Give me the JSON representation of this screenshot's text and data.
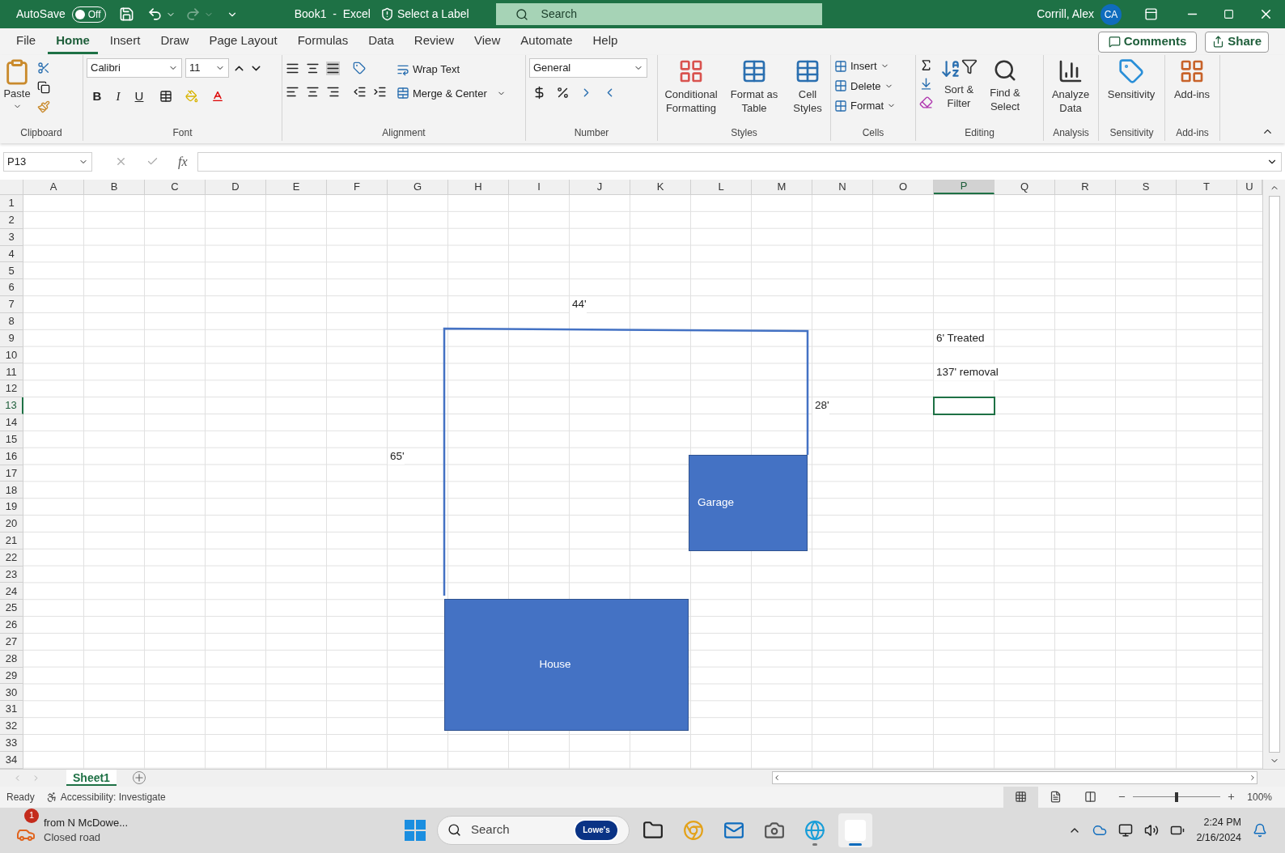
{
  "title_bar": {
    "autosave_label": "AutoSave",
    "autosave_on": false,
    "autosave_state": "Off",
    "document_title": "Book1  -  Excel",
    "sensitivity_label": "Select a Label",
    "search_placeholder": "Search",
    "user_name": "Corrill, Alex",
    "user_initials": "CA"
  },
  "ribbon_tabs": [
    {
      "label": "File",
      "selected": false
    },
    {
      "label": "Home",
      "selected": true
    },
    {
      "label": "Insert",
      "selected": false
    },
    {
      "label": "Draw",
      "selected": false
    },
    {
      "label": "Page Layout",
      "selected": false
    },
    {
      "label": "Formulas",
      "selected": false
    },
    {
      "label": "Data",
      "selected": false
    },
    {
      "label": "Review",
      "selected": false
    },
    {
      "label": "View",
      "selected": false
    },
    {
      "label": "Automate",
      "selected": false
    },
    {
      "label": "Help",
      "selected": false
    }
  ],
  "comments_button": "Comments",
  "share_button": "Share",
  "clipboard": {
    "paste": "Paste",
    "group": "Clipboard"
  },
  "font": {
    "name": "Calibri",
    "size": "11",
    "styles": [
      "B",
      "I",
      "U"
    ],
    "group": "Font"
  },
  "alignment": {
    "wrap_text": "Wrap Text",
    "merge": "Merge & Center",
    "group": "Alignment"
  },
  "number": {
    "format": "General",
    "group": "Number"
  },
  "styles": {
    "buttons": [
      "Conditional Formatting",
      "Format as Table",
      "Cell Styles"
    ],
    "group": "Styles"
  },
  "cells": {
    "buttons": [
      "Insert",
      "Delete",
      "Format"
    ],
    "group": "Cells"
  },
  "editing": {
    "buttons": [
      "Sort & Filter",
      "Find & Select"
    ],
    "group": "Editing"
  },
  "analysis": {
    "button": "Analyze Data",
    "group": "Analysis"
  },
  "sensitivity": {
    "button": "Sensitivity",
    "group": "Sensitivity"
  },
  "addins": {
    "button": "Add-ins",
    "group": "Add-ins"
  },
  "formula_bar": {
    "name_box": "P13",
    "function_label": "fx"
  },
  "columns": [
    {
      "label": "A",
      "selected": false
    },
    {
      "label": "B",
      "selected": false
    },
    {
      "label": "C",
      "selected": false
    },
    {
      "label": "D",
      "selected": false
    },
    {
      "label": "E",
      "selected": false
    },
    {
      "label": "F",
      "selected": false
    },
    {
      "label": "G",
      "selected": false
    },
    {
      "label": "H",
      "selected": false
    },
    {
      "label": "I",
      "selected": false
    },
    {
      "label": "J",
      "selected": false
    },
    {
      "label": "K",
      "selected": false
    },
    {
      "label": "L",
      "selected": false
    },
    {
      "label": "M",
      "selected": false
    },
    {
      "label": "N",
      "selected": false
    },
    {
      "label": "O",
      "selected": false
    },
    {
      "label": "P",
      "selected": true
    },
    {
      "label": "Q",
      "selected": false
    },
    {
      "label": "R",
      "selected": false
    },
    {
      "label": "S",
      "selected": false
    },
    {
      "label": "T",
      "selected": false
    },
    {
      "label": "U",
      "selected": false
    }
  ],
  "rows": [
    {
      "header": "1",
      "selected": false
    },
    {
      "header": "2",
      "selected": false
    },
    {
      "header": "3",
      "selected": false
    },
    {
      "header": "4",
      "selected": false
    },
    {
      "header": "5",
      "selected": false
    },
    {
      "header": "6",
      "selected": false
    },
    {
      "header": "7",
      "selected": false,
      "cells": {
        "J": "44'"
      }
    },
    {
      "header": "8",
      "selected": false
    },
    {
      "header": "9",
      "selected": false,
      "cells": {
        "P": "6' Treated"
      }
    },
    {
      "header": "10",
      "selected": false
    },
    {
      "header": "11",
      "selected": false,
      "cells": {
        "P": "137' removal"
      }
    },
    {
      "header": "12",
      "selected": false
    },
    {
      "header": "13",
      "selected": true,
      "cells": {
        "N": "28'"
      }
    },
    {
      "header": "14",
      "selected": false
    },
    {
      "header": "15",
      "selected": false
    },
    {
      "header": "16",
      "selected": false,
      "cells": {
        "G": "65'"
      }
    },
    {
      "header": "17",
      "selected": false
    },
    {
      "header": "18",
      "selected": false
    },
    {
      "header": "19",
      "selected": false
    },
    {
      "header": "20",
      "selected": false
    },
    {
      "header": "21",
      "selected": false
    },
    {
      "header": "22",
      "selected": false
    },
    {
      "header": "23",
      "selected": false
    },
    {
      "header": "24",
      "selected": false
    },
    {
      "header": "25",
      "selected": false
    },
    {
      "header": "26",
      "selected": false
    },
    {
      "header": "27",
      "selected": false
    },
    {
      "header": "28",
      "selected": false
    },
    {
      "header": "29",
      "selected": false
    },
    {
      "header": "30",
      "selected": false
    },
    {
      "header": "31",
      "selected": false
    },
    {
      "header": "32",
      "selected": false
    },
    {
      "header": "33",
      "selected": false
    },
    {
      "header": "34",
      "selected": false
    }
  ],
  "shapes": [
    {
      "label": "Garage"
    },
    {
      "label": "House"
    }
  ],
  "sheet_tabs": [
    {
      "label": "Sheet1",
      "selected": true
    }
  ],
  "status_bar": {
    "ready": "Ready",
    "accessibility": "Accessibility: Investigate",
    "views": [
      {
        "kind": "normal",
        "selected": true
      },
      {
        "kind": "page_layout",
        "selected": false
      },
      {
        "kind": "page_break",
        "selected": false
      }
    ],
    "zoom_slider": {
      "level": 0.5
    },
    "zoom": "100%"
  },
  "taskbar": {
    "notification": {
      "badge": "1",
      "title": "from N McDowe...",
      "subtitle": "Closed road"
    },
    "search_placeholder": "Search",
    "search_logo": "Lowe's",
    "apps": [
      {
        "kind": "files",
        "active": false
      },
      {
        "kind": "chrome",
        "active": false
      },
      {
        "kind": "outlook",
        "active": false
      },
      {
        "kind": "camera",
        "active": false
      },
      {
        "kind": "edge",
        "active": false,
        "running": true
      },
      {
        "kind": "blank",
        "active": true
      }
    ],
    "time": "2:24 PM",
    "date": "2/16/2024"
  }
}
